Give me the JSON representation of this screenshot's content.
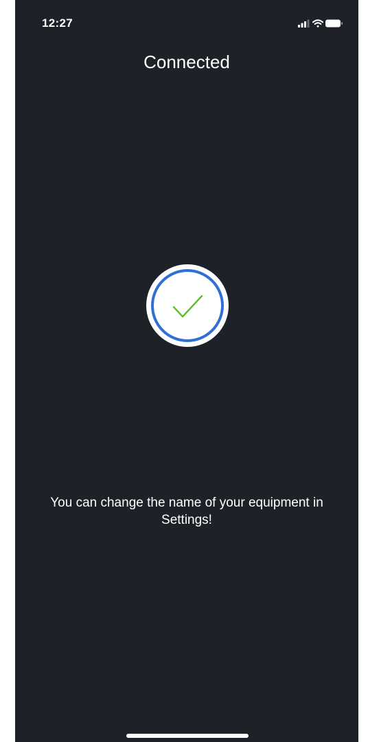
{
  "status_bar": {
    "time": "12:27",
    "icons": [
      "cellular-signal-icon",
      "wifi-icon",
      "battery-icon"
    ]
  },
  "header": {
    "title": "Connected"
  },
  "status_indicator": {
    "icon": "checkmark-icon",
    "ring_color": "#2f6fd6",
    "check_color": "#5cc02a"
  },
  "message": {
    "text": "You can change the name of your equipment in Settings!"
  },
  "colors": {
    "background": "#1f2128",
    "text": "#ffffff"
  }
}
